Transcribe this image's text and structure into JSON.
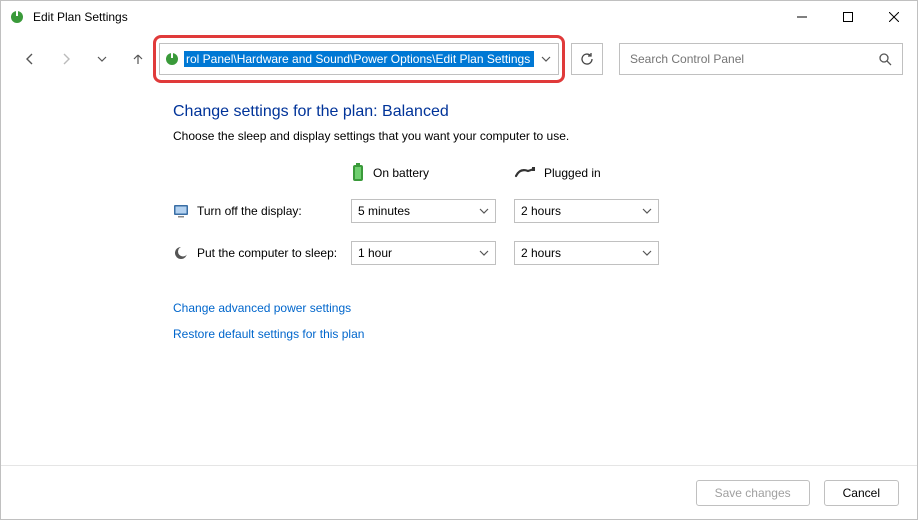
{
  "window": {
    "title": "Edit Plan Settings"
  },
  "address": {
    "path": "rol Panel\\Hardware and Sound\\Power Options\\Edit Plan Settings"
  },
  "search": {
    "placeholder": "Search Control Panel"
  },
  "page": {
    "heading": "Change settings for the plan: Balanced",
    "subtext": "Choose the sleep and display settings that you want your computer to use."
  },
  "columns": {
    "battery": "On battery",
    "plugged": "Plugged in"
  },
  "settings": {
    "display": {
      "label": "Turn off the display:",
      "battery": "5 minutes",
      "plugged": "2 hours"
    },
    "sleep": {
      "label": "Put the computer to sleep:",
      "battery": "1 hour",
      "plugged": "2 hours"
    }
  },
  "links": {
    "advanced": "Change advanced power settings",
    "restore": "Restore default settings for this plan"
  },
  "buttons": {
    "save": "Save changes",
    "cancel": "Cancel"
  }
}
